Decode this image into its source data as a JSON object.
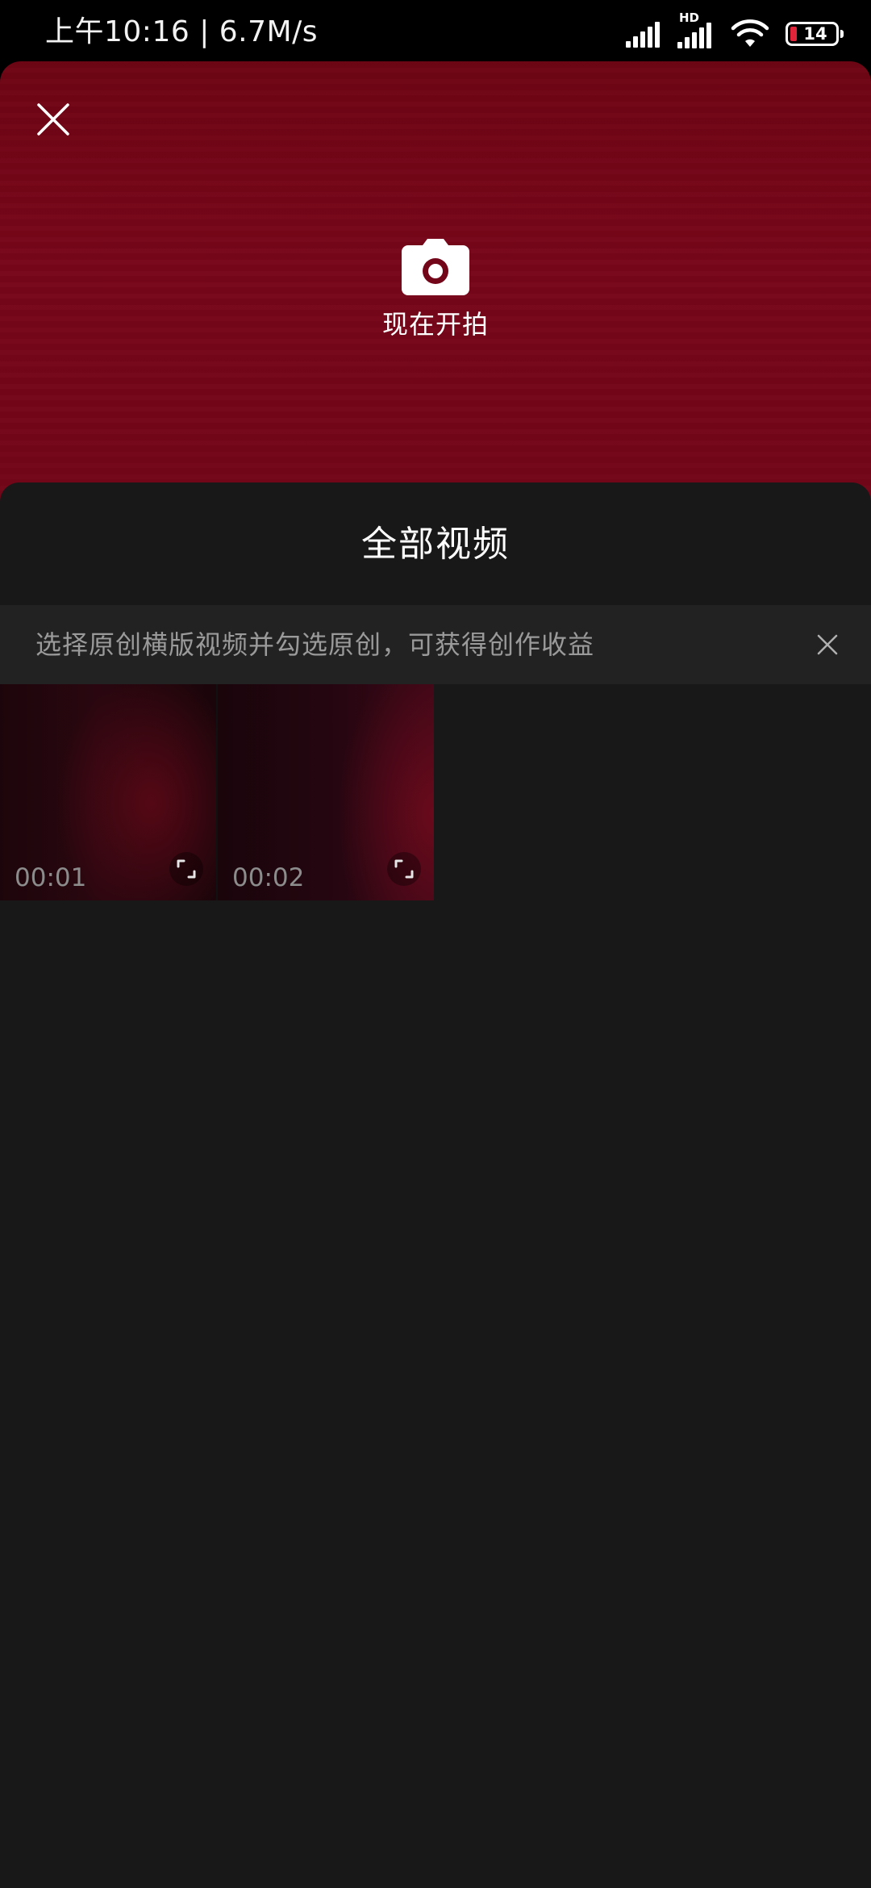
{
  "status_bar": {
    "time_speed": "上午10:16 | 6.7M/s",
    "hd_label": "HD",
    "battery_level": "14"
  },
  "camera": {
    "close_icon": "close-icon",
    "camera_icon": "camera-icon",
    "label": "现在开拍"
  },
  "sheet": {
    "title": "全部视频",
    "notice": {
      "text": "选择原创横版视频并勾选原创，可获得创作收益",
      "close_icon": "close-icon"
    },
    "videos": [
      {
        "duration": "00:01",
        "expand_icon": "expand-icon"
      },
      {
        "duration": "00:02",
        "expand_icon": "expand-icon"
      }
    ]
  },
  "colors": {
    "camera_bg": "#75061a",
    "sheet_bg": "#181818",
    "notice_bg": "#222222",
    "battery_low": "#e0243a"
  }
}
